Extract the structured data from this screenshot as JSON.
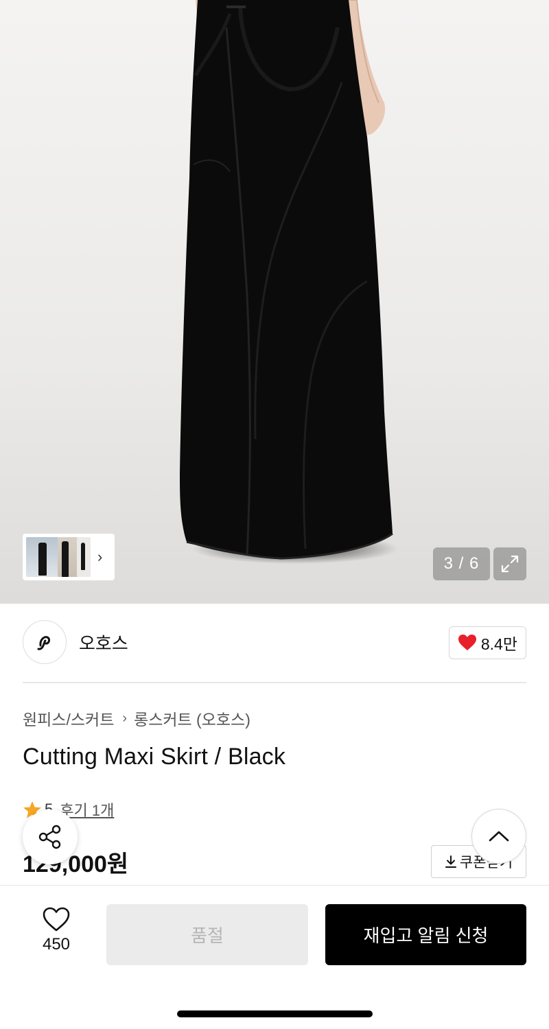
{
  "gallery": {
    "current": 3,
    "total": 6,
    "counter_text": "3 / 6"
  },
  "brand": {
    "name": "오호스",
    "likes": "8.4만"
  },
  "product": {
    "breadcrumb": [
      "원피스/스커트",
      "롱스커트 (오호스)"
    ],
    "title": "Cutting Maxi Skirt / Black",
    "rating": "5",
    "review_text": "후기 1개",
    "price": "129,000원",
    "coupon_label": "쿠폰받기"
  },
  "bottom_bar": {
    "wish_count": "450",
    "soldout_label": "품절",
    "restock_label": "재입고 알림 신청"
  },
  "colors": {
    "heart": "#e8202a",
    "star": "#f5a623",
    "primary_button": "#000000",
    "disabled_button": "#ebebeb"
  }
}
